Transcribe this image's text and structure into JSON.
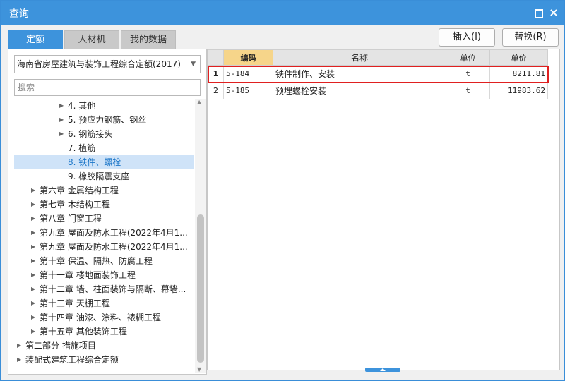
{
  "window": {
    "title": "查询"
  },
  "titlebar_icons": {
    "maximize": "maximize-icon",
    "close": "close-icon",
    "close_glyph": "×"
  },
  "tabs": [
    {
      "label": "定额",
      "active": true
    },
    {
      "label": "人材机",
      "active": false
    },
    {
      "label": "我的数据",
      "active": false
    }
  ],
  "actions": {
    "insert_label": "插入(I)",
    "replace_label": "替换(R)"
  },
  "library_select": {
    "value": "海南省房屋建筑与装饰工程综合定额(2017)"
  },
  "search": {
    "placeholder": "搜索",
    "value": ""
  },
  "tree": [
    {
      "label": "4. 其他",
      "level": 3,
      "expandable": true,
      "selected": false
    },
    {
      "label": "5. 预应力钢筋、钢丝",
      "level": 3,
      "expandable": true,
      "selected": false
    },
    {
      "label": "6. 钢筋接头",
      "level": 3,
      "expandable": true,
      "selected": false
    },
    {
      "label": "7. 植筋",
      "level": 3,
      "expandable": false,
      "selected": false
    },
    {
      "label": "8. 铁件、螺栓",
      "level": 3,
      "expandable": false,
      "selected": true
    },
    {
      "label": "9. 橡胶隔震支座",
      "level": 3,
      "expandable": false,
      "selected": false
    },
    {
      "label": "第六章 金属结构工程",
      "level": 2,
      "expandable": true,
      "selected": false
    },
    {
      "label": "第七章 木结构工程",
      "level": 2,
      "expandable": true,
      "selected": false
    },
    {
      "label": "第八章 门窗工程",
      "level": 2,
      "expandable": true,
      "selected": false
    },
    {
      "label": "第九章 屋面及防水工程(2022年4月1...",
      "level": 2,
      "expandable": true,
      "selected": false
    },
    {
      "label": "第九章 屋面及防水工程(2022年4月1...",
      "level": 2,
      "expandable": true,
      "selected": false
    },
    {
      "label": "第十章 保温、隔热、防腐工程",
      "level": 2,
      "expandable": true,
      "selected": false
    },
    {
      "label": "第十一章 楼地面装饰工程",
      "level": 2,
      "expandable": true,
      "selected": false
    },
    {
      "label": "第十二章 墙、柱面装饰与隔断、幕墙...",
      "level": 2,
      "expandable": true,
      "selected": false
    },
    {
      "label": "第十三章 天棚工程",
      "level": 2,
      "expandable": true,
      "selected": false
    },
    {
      "label": "第十四章 油漆、涂料、裱糊工程",
      "level": 2,
      "expandable": true,
      "selected": false
    },
    {
      "label": "第十五章 其他装饰工程",
      "level": 2,
      "expandable": true,
      "selected": false
    },
    {
      "label": "第二部分 措施项目",
      "level": 1,
      "expandable": true,
      "selected": false
    },
    {
      "label": "装配式建筑工程综合定额",
      "level": 1,
      "expandable": true,
      "selected": false
    }
  ],
  "table": {
    "columns": [
      "编码",
      "名称",
      "单位",
      "单价"
    ],
    "rows": [
      {
        "num": "1",
        "code": "5-184",
        "name": "铁件制作、安装",
        "unit": "t",
        "price": "8211.81",
        "selected": true
      },
      {
        "num": "2",
        "code": "5-185",
        "name": "预埋螺栓安装",
        "unit": "t",
        "price": "11983.62",
        "selected": false
      }
    ]
  },
  "colors": {
    "accent": "#3d93dc",
    "code_header": "#f6d58a",
    "highlight": "#e02020",
    "tree_selected": "#cfe3f8"
  }
}
